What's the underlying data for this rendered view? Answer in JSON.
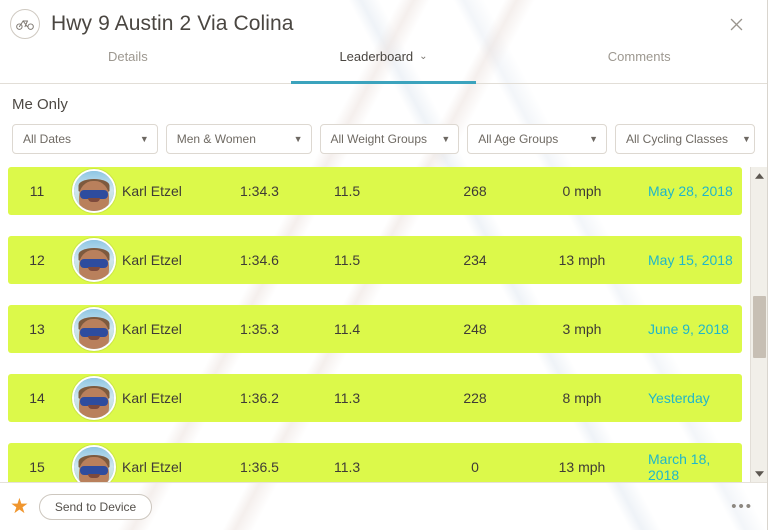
{
  "header": {
    "title": "Hwy 9 Austin 2 Via Colina",
    "bike_icon": "bicycle-icon",
    "close_icon": "close-icon"
  },
  "tabs": [
    {
      "label": "Details",
      "active": false,
      "caret": ""
    },
    {
      "label": "Leaderboard",
      "active": true,
      "caret": "⌄"
    },
    {
      "label": "Comments",
      "active": false,
      "caret": ""
    }
  ],
  "filters": {
    "scope_label": "Me Only",
    "selects": [
      {
        "value": "All Dates",
        "caret": "▼"
      },
      {
        "value": "Men & Women",
        "caret": "▼"
      },
      {
        "value": "All Weight Groups",
        "caret": "▼"
      },
      {
        "value": "All Age Groups",
        "caret": "▼"
      },
      {
        "value": "All Cycling Classes",
        "caret": "▼"
      }
    ]
  },
  "leaderboard": {
    "rows": [
      {
        "rank": "11",
        "name": "Karl Etzel",
        "time": "1:34.3",
        "speed": "11.5",
        "power": "268",
        "wind": "0 mph",
        "date": "May 28, 2018"
      },
      {
        "rank": "12",
        "name": "Karl Etzel",
        "time": "1:34.6",
        "speed": "11.5",
        "power": "234",
        "wind": "13 mph",
        "date": "May 15, 2018"
      },
      {
        "rank": "13",
        "name": "Karl Etzel",
        "time": "1:35.3",
        "speed": "11.4",
        "power": "248",
        "wind": "3 mph",
        "date": "June 9, 2018"
      },
      {
        "rank": "14",
        "name": "Karl Etzel",
        "time": "1:36.2",
        "speed": "11.3",
        "power": "228",
        "wind": "8 mph",
        "date": "Yesterday"
      },
      {
        "rank": "15",
        "name": "Karl Etzel",
        "time": "1:36.5",
        "speed": "11.3",
        "power": "0",
        "wind": "13 mph",
        "date": "March 18, 2018"
      }
    ],
    "row_color": "#dcf94a",
    "date_color": "#20b6c9"
  },
  "scrollbar": {
    "up_icon": "chevron-up-icon",
    "down_icon": "chevron-down-icon",
    "thumb_position_percent": 40
  },
  "bottom": {
    "star_icon": "star-icon",
    "star_color": "#f0962e",
    "send_label": "Send to Device",
    "more_icon": "more-options-icon",
    "more_glyph": "•••"
  }
}
